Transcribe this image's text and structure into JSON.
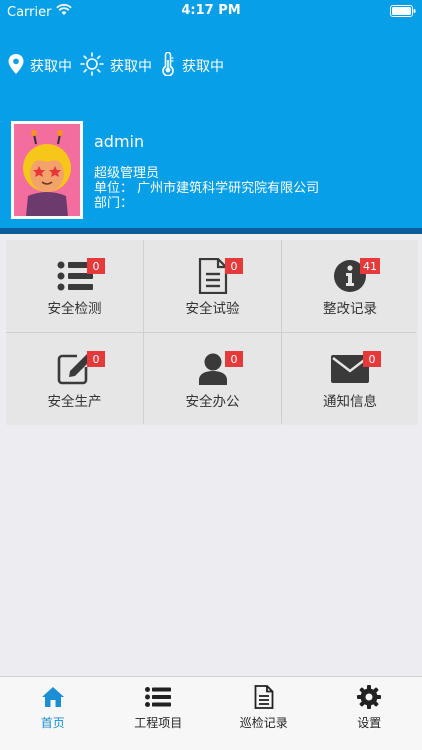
{
  "status_bar": {
    "carrier": "Carrier",
    "time": "4:17 PM"
  },
  "weather": {
    "location": "获取中",
    "weather": "获取中",
    "temperature": "获取中"
  },
  "profile": {
    "name": "admin",
    "role": "超级管理员",
    "unit": "单位：  广州市建筑科学研究院有限公司",
    "department": "部门："
  },
  "grid": [
    {
      "label": "安全检测",
      "badge": "0",
      "icon": "list-icon"
    },
    {
      "label": "安全试验",
      "badge": "0",
      "icon": "document-icon"
    },
    {
      "label": "整改记录",
      "badge": "41",
      "icon": "info-icon"
    },
    {
      "label": "安全生产",
      "badge": "0",
      "icon": "edit-icon"
    },
    {
      "label": "安全办公",
      "badge": "0",
      "icon": "user-icon"
    },
    {
      "label": "通知信息",
      "badge": "0",
      "icon": "mail-icon"
    }
  ],
  "tabs": [
    {
      "label": "首页",
      "icon": "home-icon",
      "active": true
    },
    {
      "label": "工程项目",
      "icon": "list-icon",
      "active": false
    },
    {
      "label": "巡检记录",
      "icon": "document-icon",
      "active": false
    },
    {
      "label": "设置",
      "icon": "gear-icon",
      "active": false
    }
  ],
  "colors": {
    "header": "#079fe7",
    "header_underline": "#0b5e9c",
    "badge": "#e5393a",
    "active_tab": "#1a8fd6"
  }
}
